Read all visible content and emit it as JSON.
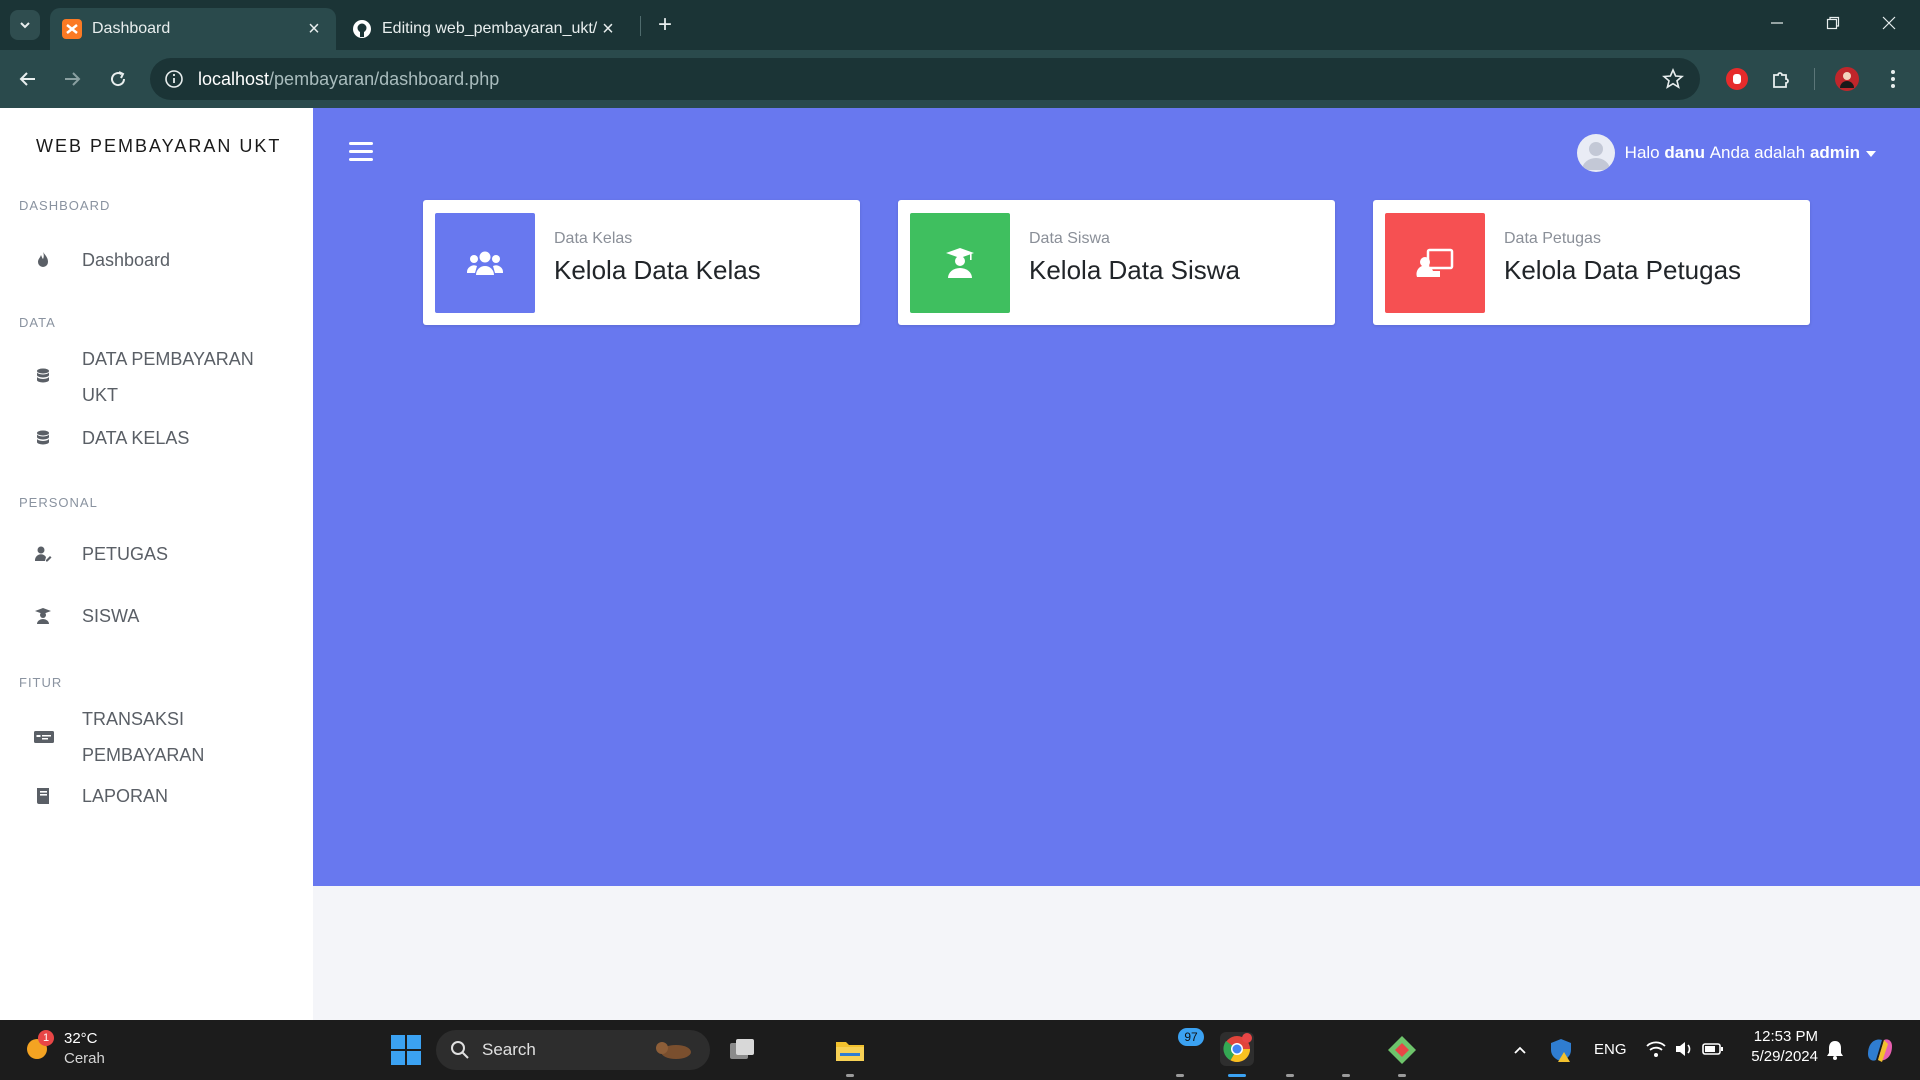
{
  "browser": {
    "tabs": [
      {
        "title": "Dashboard",
        "active": true
      },
      {
        "title": "Editing web_pembayaran_ukt/R",
        "active": false
      }
    ],
    "url_host": "localhost",
    "url_path": "/pembayaran/dashboard.php"
  },
  "sidebar": {
    "brand": "WEB PEMBAYARAN UKT",
    "sections": [
      {
        "title": "DASHBOARD",
        "items": [
          {
            "label": "Dashboard",
            "icon": "fire-icon"
          }
        ]
      },
      {
        "title": "DATA",
        "items": [
          {
            "label": "DATA PEMBAYARAN UKT",
            "icon": "database-icon"
          },
          {
            "label": "DATA KELAS",
            "icon": "database-icon"
          }
        ]
      },
      {
        "title": "PERSONAL",
        "items": [
          {
            "label": "PETUGAS",
            "icon": "user-edit-icon"
          },
          {
            "label": "SISWA",
            "icon": "user-graduate-icon"
          }
        ]
      },
      {
        "title": "FITUR",
        "items": [
          {
            "label": "TRANSAKSI PEMBAYARAN",
            "icon": "money-check-icon"
          },
          {
            "label": "LAPORAN",
            "icon": "book-icon"
          }
        ]
      }
    ]
  },
  "header": {
    "greeting": "Halo",
    "username": "danu",
    "role_prefix": "Anda adalah",
    "role": "admin"
  },
  "cards": [
    {
      "subtitle": "Data Kelas",
      "title": "Kelola Data Kelas",
      "color": "#6878ef",
      "icon": "users-icon"
    },
    {
      "subtitle": "Data Siswa",
      "title": "Kelola Data Siswa",
      "color": "#3fbf5f",
      "icon": "user-graduate-icon"
    },
    {
      "subtitle": "Data Petugas",
      "title": "Kelola Data Petugas",
      "color": "#f65052",
      "icon": "chalkboard-teacher-icon"
    }
  ],
  "colors": {
    "accent": "#6878ef",
    "chrome": "#2a4a4c",
    "sidebar_bg": "#ffffff"
  },
  "taskbar": {
    "weather_temp": "32°C",
    "weather_desc": "Cerah",
    "weather_badge": "1",
    "search_label": "Search",
    "app_badge": "97",
    "lang": "ENG",
    "time": "12:53 PM",
    "date": "5/29/2024"
  }
}
